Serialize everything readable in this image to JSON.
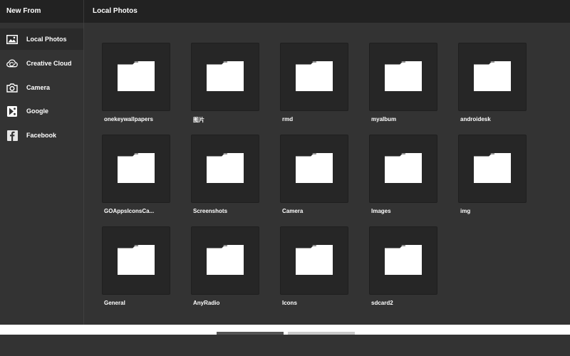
{
  "sidebar": {
    "title": "New From",
    "items": [
      {
        "label": "Local Photos",
        "icon": "image-icon",
        "active": true
      },
      {
        "label": "Creative Cloud",
        "icon": "creative-cloud-icon",
        "active": false
      },
      {
        "label": "Camera",
        "icon": "camera-icon",
        "active": false
      },
      {
        "label": "Google",
        "icon": "google-icon",
        "active": false
      },
      {
        "label": "Facebook",
        "icon": "facebook-icon",
        "active": false
      }
    ]
  },
  "main": {
    "title": "Local Photos",
    "folders": [
      {
        "label": "onekeywallpapers"
      },
      {
        "label": "图片"
      },
      {
        "label": "rmd"
      },
      {
        "label": "myalbum"
      },
      {
        "label": "androidesk"
      },
      {
        "label": "GOAppsIconsCa..."
      },
      {
        "label": "Screenshots"
      },
      {
        "label": "Camera"
      },
      {
        "label": "Images"
      },
      {
        "label": "img"
      },
      {
        "label": "General"
      },
      {
        "label": "AnyRadio"
      },
      {
        "label": "Icons"
      },
      {
        "label": "sdcard2"
      }
    ]
  },
  "colors": {
    "background": "#333333",
    "header": "#222222",
    "tile": "#262626",
    "text": "#ffffff"
  }
}
